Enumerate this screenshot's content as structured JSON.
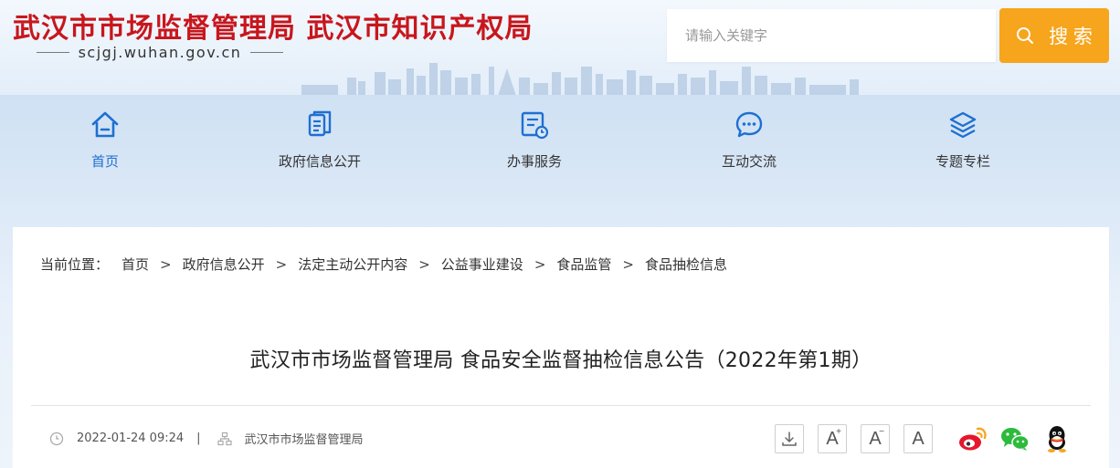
{
  "header": {
    "site_title": "武汉市市场监督管理局 武汉市知识产权局",
    "domain": "scjgj.wuhan.gov.cn",
    "search": {
      "placeholder": "请输入关键字",
      "button_label": "搜 索"
    }
  },
  "nav": {
    "items": [
      {
        "label": "首页",
        "icon": "home-icon",
        "active": true
      },
      {
        "label": "政府信息公开",
        "icon": "documents-icon",
        "active": false
      },
      {
        "label": "办事服务",
        "icon": "service-form-icon",
        "active": false
      },
      {
        "label": "互动交流",
        "icon": "chat-bubble-icon",
        "active": false
      },
      {
        "label": "专题专栏",
        "icon": "layers-icon",
        "active": false
      }
    ],
    "active_color": "#1f6fd1"
  },
  "breadcrumb": {
    "prefix": "当前位置：",
    "separator": ">",
    "items": [
      "首页",
      "政府信息公开",
      "法定主动公开内容",
      "公益事业建设",
      "食品监管",
      "食品抽检信息"
    ]
  },
  "article": {
    "title": "武汉市市场监督管理局 食品安全监督抽检信息公告（2022年第1期）",
    "date": "2022-01-24 09:24",
    "separator": "|",
    "source": "武汉市市场监督管理局"
  },
  "tools": {
    "download_icon": "download-icon",
    "font_larger": "A",
    "font_smaller": "A",
    "font_default": "A",
    "share": [
      "weibo-icon",
      "wechat-icon",
      "qq-icon"
    ]
  },
  "colors": {
    "title_red": "#c8161d",
    "search_orange": "#f7a51c",
    "nav_active_blue": "#1f6fd1"
  }
}
